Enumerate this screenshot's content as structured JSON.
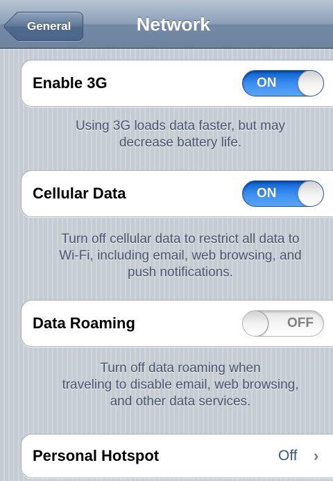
{
  "navbar": {
    "back_label": "General",
    "title": "Network"
  },
  "settings": [
    {
      "label": "Enable 3G",
      "toggle": "ON",
      "note_lines": [
        "Using 3G loads data faster, but may",
        "decrease battery life."
      ]
    },
    {
      "label": "Cellular Data",
      "toggle": "ON",
      "note_lines": [
        "Turn off cellular data to restrict all data to",
        "Wi-Fi, including email, web browsing, and",
        "push notifications."
      ]
    },
    {
      "label": "Data Roaming",
      "toggle": "OFF",
      "note_lines": [
        "Turn off data roaming when",
        "traveling to disable email, web browsing,",
        "and other data services."
      ]
    }
  ],
  "hotspot": {
    "label": "Personal Hotspot",
    "value": "Off",
    "chevron_icon": "chevron-right-icon"
  },
  "colors": {
    "nav_bar": "#7389a4",
    "toggle_on": "#3a8df0",
    "note_text": "#4c566c",
    "detail_value": "#385487"
  }
}
